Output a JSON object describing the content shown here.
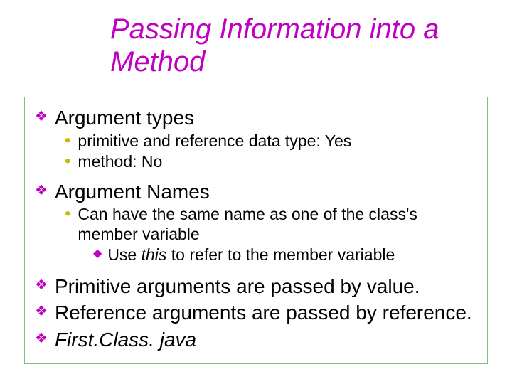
{
  "title": "Passing Information into a Method",
  "items": [
    {
      "text": "Argument types",
      "sub": [
        {
          "text": "primitive and reference data type: Yes"
        },
        {
          "text": "method: No"
        }
      ]
    },
    {
      "text": "Argument Names",
      "sub": [
        {
          "text": "Can have the same name as one of the class's member variable",
          "sub": [
            {
              "pre": "Use ",
              "kw": "this",
              "post": " to refer to the member variable"
            }
          ]
        }
      ]
    },
    {
      "text": "Primitive arguments are passed by value."
    },
    {
      "text": "Reference arguments are passed by reference."
    },
    {
      "text": "First.Class. java",
      "italic": true
    }
  ]
}
